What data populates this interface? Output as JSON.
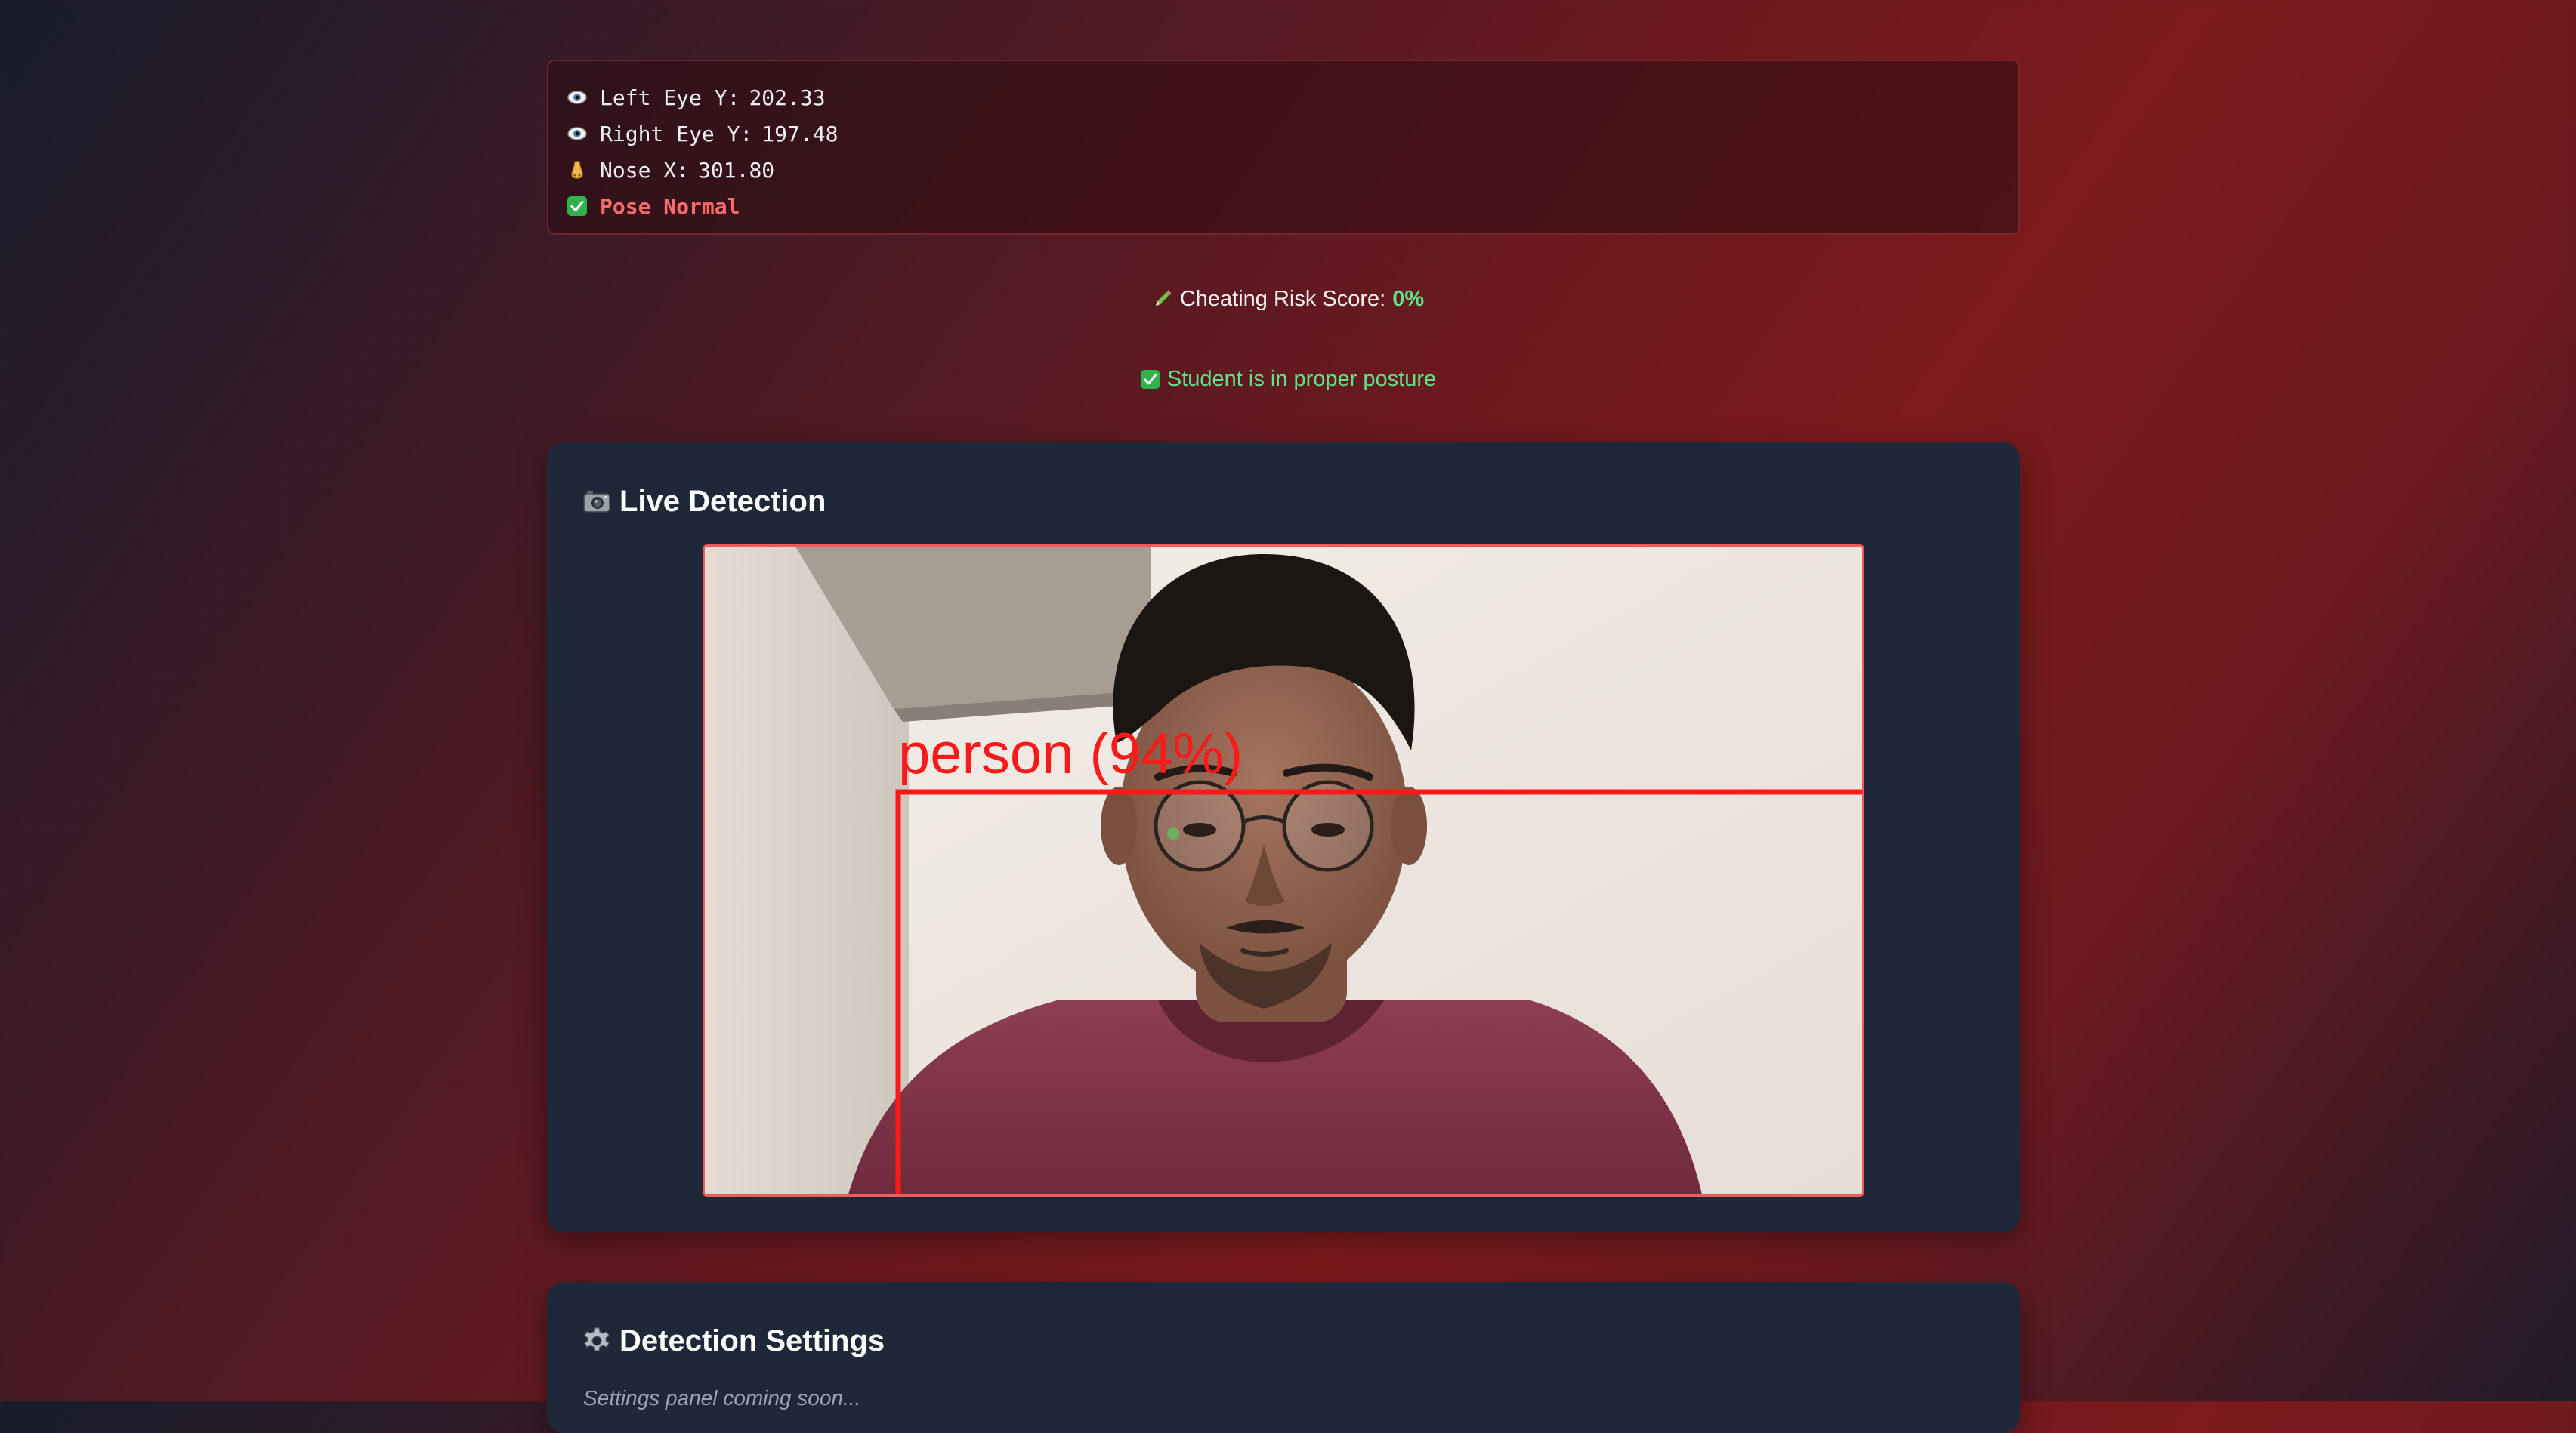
{
  "pose_stats": {
    "left_eye": {
      "label": "Left Eye Y:",
      "value": "202.33",
      "icon": "eye-icon"
    },
    "right_eye": {
      "label": "Right Eye Y:",
      "value": "197.48",
      "icon": "eye-icon"
    },
    "nose": {
      "label": "Nose X:",
      "value": "301.80",
      "icon": "nose-icon"
    },
    "status": {
      "label": "Pose Normal",
      "icon": "check-icon",
      "color": "#ff6b6b"
    }
  },
  "risk": {
    "label": "Cheating Risk Score:",
    "value": "0%",
    "icon": "pencil-icon",
    "value_color": "#5ee38a"
  },
  "posture": {
    "message": "Student is in proper posture",
    "icon": "check-icon",
    "color": "#5ee38a"
  },
  "live_detection": {
    "title": "Live Detection",
    "icon": "camera-icon",
    "detection": {
      "label": "person (94%)",
      "color": "#ff1a1a"
    }
  },
  "settings": {
    "title": "Detection Settings",
    "icon": "gear-icon",
    "text": "Settings panel coming soon..."
  },
  "colors": {
    "card_bg": "#1f2839",
    "accent_red": "#f05a5a",
    "success_green": "#5ee38a"
  }
}
